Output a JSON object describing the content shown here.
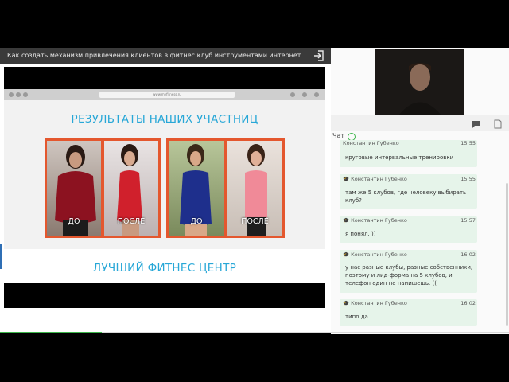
{
  "window": {
    "title": "Как создать механизм привлечения клиентов в фитнес клуб инструментами интернет-марк…"
  },
  "slide": {
    "url": "www.myfitness.ru",
    "results_heading": "РЕЗУЛЬТАТЫ НАШИХ УЧАСТНИЦ",
    "best_heading": "ЛУЧШИЙ ФИТНЕС ЦЕНТР",
    "captions": {
      "before": "ДО",
      "after": "ПОСЛЕ"
    }
  },
  "chat": {
    "title": "Чат",
    "messages": [
      {
        "author": "Константин Губенко",
        "time": "15:55",
        "text": "круговые интервальные тренировки"
      },
      {
        "author": "Константин Губенко",
        "time": "15:55",
        "text": "там же 5 клубов, где человеку выбирать клуб?"
      },
      {
        "author": "Константин Губенко",
        "time": "15:57",
        "text": "я понял. ))"
      },
      {
        "author": "Константин Губенко",
        "time": "16:02",
        "text": "у нас разные клубы, разные собственники, поэтому и лид-форма на 5 клубов, и телефон один не напишешь. (("
      },
      {
        "author": "Константин Губенко",
        "time": "16:02",
        "text": "типо да"
      }
    ]
  },
  "colors": {
    "accent_blue": "#27a7d7",
    "photo_border": "#e4572e",
    "chat_bubble": "#e6f4ea",
    "green": "#3cb54a"
  }
}
